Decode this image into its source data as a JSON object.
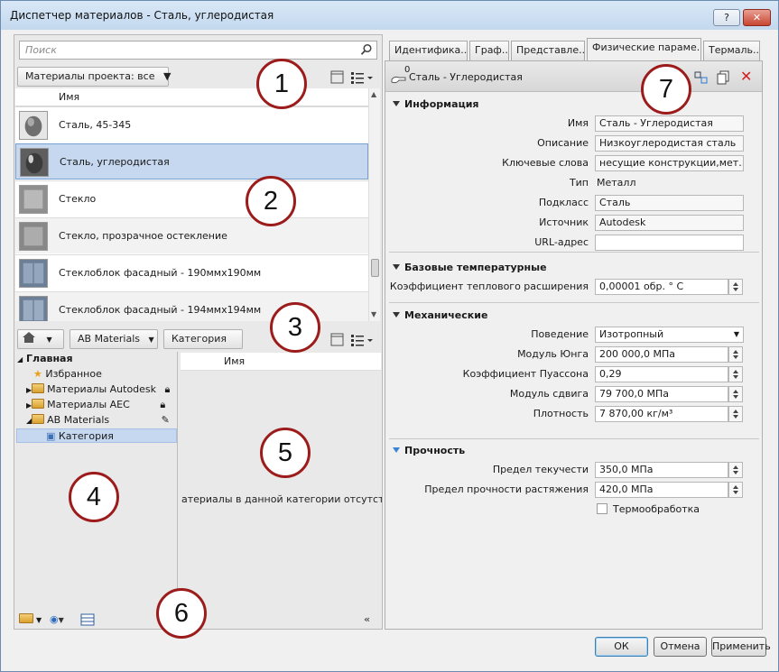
{
  "window": {
    "title": "Диспетчер материалов - Сталь, углеродистая",
    "help_label": "?",
    "close_label": "✕"
  },
  "search": {
    "placeholder": "Поиск"
  },
  "project_filter": {
    "label": "Материалы проекта: все"
  },
  "materials_list": {
    "column_header": "Имя",
    "items": [
      {
        "name": "Сталь, 45-345"
      },
      {
        "name": "Сталь, углеродистая"
      },
      {
        "name": "Стекло"
      },
      {
        "name": "Стекло, прозрачное остекление"
      },
      {
        "name": "Стеклоблок фасадный - 190ммх190мм"
      },
      {
        "name": "Стеклоблок фасадный - 194ммх194мм"
      }
    ],
    "selected_index": 1
  },
  "library": {
    "breadcrumb": [
      "AB Materials",
      "Категория"
    ],
    "tree": [
      {
        "label": "Главная"
      },
      {
        "label": "Избранное"
      },
      {
        "label": "Материалы Autodesk"
      },
      {
        "label": "Материалы AEC"
      },
      {
        "label": "AB Materials"
      },
      {
        "label": "Категория"
      }
    ],
    "content_header": "Имя",
    "empty_message": "атериалы в данной категории отсутствуют"
  },
  "tabs": [
    {
      "label": "Идентифика..."
    },
    {
      "label": "Граф..."
    },
    {
      "label": "Представле..."
    },
    {
      "label": "Физические параме..."
    },
    {
      "label": "Термаль..."
    }
  ],
  "asset": {
    "count": "0",
    "name": "Сталь - Углеродистая"
  },
  "info": {
    "title": "Информация",
    "name_label": "Имя",
    "name_value": "Сталь - Углеродистая",
    "desc_label": "Описание",
    "desc_value": "Низкоуглеродистая сталь",
    "keywords_label": "Ключевые слова",
    "keywords_value": "несущие конструкции,мет...",
    "type_label": "Тип",
    "type_value": "Металл",
    "subclass_label": "Подкласс",
    "subclass_value": "Сталь",
    "source_label": "Источник",
    "source_value": "Autodesk",
    "url_label": "URL-адрес",
    "url_value": ""
  },
  "thermal": {
    "title": "Базовые температурные",
    "coef_label": "Коэффициент теплового расширения",
    "coef_value": "0,00001 обр. ° С"
  },
  "mechanical": {
    "title": "Механические",
    "behavior_label": "Поведение",
    "behavior_value": "Изотропный",
    "young_label": "Модуль Юнга",
    "young_value": "200 000,0 МПа",
    "poisson_label": "Коэффициент Пуассона",
    "poisson_value": "0,29",
    "shear_label": "Модуль сдвига",
    "shear_value": "79 700,0 МПа",
    "density_label": "Плотность",
    "density_value": "7 870,00 кг/м³"
  },
  "strength": {
    "title": "Прочность",
    "yield_label": "Предел текучести",
    "yield_value": "350,0 МПа",
    "tensile_label": "Предел прочности растяжения",
    "tensile_value": "420,0 МПа",
    "heat_label": "Термообработка"
  },
  "footer": {
    "ok": "ОК",
    "cancel": "Отмена",
    "apply": "Применить"
  },
  "callouts": [
    "1",
    "2",
    "3",
    "4",
    "5",
    "6",
    "7"
  ]
}
